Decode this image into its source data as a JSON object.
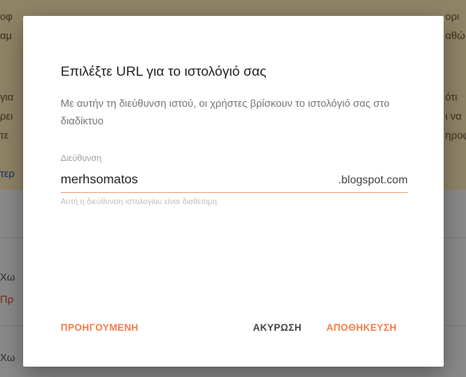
{
  "background": {
    "fragments_top": [
      "οφ",
      "αμ",
      "για",
      "ρει",
      "τε",
      "τερ",
      "ορι",
      "αθώ",
      "ότι",
      "ι να",
      "ηροφ"
    ],
    "fragments_bottom": [
      "Χω",
      "Πρ",
      "Χω"
    ]
  },
  "dialog": {
    "title": "Επιλέξτε URL για το ιστολόγιό σας",
    "description": "Με αυτήν τη διεύθυνση ιστού, οι χρήστες βρίσκουν το ιστολόγιό σας στο διαδίκτυο",
    "field_label": "Διεύθυνση",
    "url_value": "merhsomatos",
    "url_suffix": ".blogspot.com",
    "availability_hint": "Αυτή η διεύθυνση ιστολογίου είναι διαθέσιμη.",
    "buttons": {
      "previous": "ΠΡΟΗΓΟΥΜΕΝΗ",
      "cancel": "ΑΚΥΡΩΣΗ",
      "save": "ΑΠΟΘΗΚΕΥΣΗ"
    }
  },
  "colors": {
    "accent": "#f57c4a",
    "underline": "#f4a582",
    "overlay_top": "#8f8466",
    "overlay_bottom": "#8a8a8a"
  }
}
